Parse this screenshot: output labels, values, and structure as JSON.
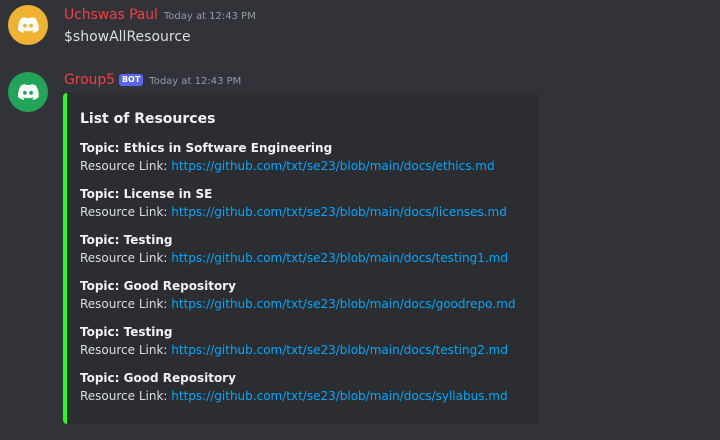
{
  "messages": [
    {
      "author": "Uchswas Paul",
      "author_color": "#f23f43",
      "avatar_color": "#f0b232",
      "timestamp": "Today at 12:43 PM",
      "content": "$showAllResource"
    },
    {
      "author": "Group5",
      "author_color": "#f23f43",
      "avatar_color": "#23a559",
      "bot_tag": "BOT",
      "timestamp": "Today at 12:43 PM",
      "embed": {
        "accent_color": "#23ff1c",
        "title": "List of Resources",
        "fields": [
          {
            "name": "Topic: Ethics in Software Engineering",
            "label": "Resource Link: ",
            "link": "https://github.com/txt/se23/blob/main/docs/ethics.md"
          },
          {
            "name": "Topic: License in  SE",
            "label": "Resource Link: ",
            "link": "https://github.com/txt/se23/blob/main/docs/licenses.md"
          },
          {
            "name": "Topic: Testing",
            "label": "Resource Link: ",
            "link": "https://github.com/txt/se23/blob/main/docs/testing1.md"
          },
          {
            "name": "Topic: Good Repository",
            "label": "Resource Link: ",
            "link": "https://github.com/txt/se23/blob/main/docs/goodrepo.md"
          },
          {
            "name": "Topic: Testing",
            "label": "Resource Link: ",
            "link": "https://github.com/txt/se23/blob/main/docs/testing2.md"
          },
          {
            "name": "Topic: Good Repository",
            "label": "Resource Link: ",
            "link": "https://github.com/txt/se23/blob/main/docs/syllabus.md"
          }
        ]
      }
    }
  ],
  "icons": {
    "avatar_icon": "discord-logo-icon"
  }
}
